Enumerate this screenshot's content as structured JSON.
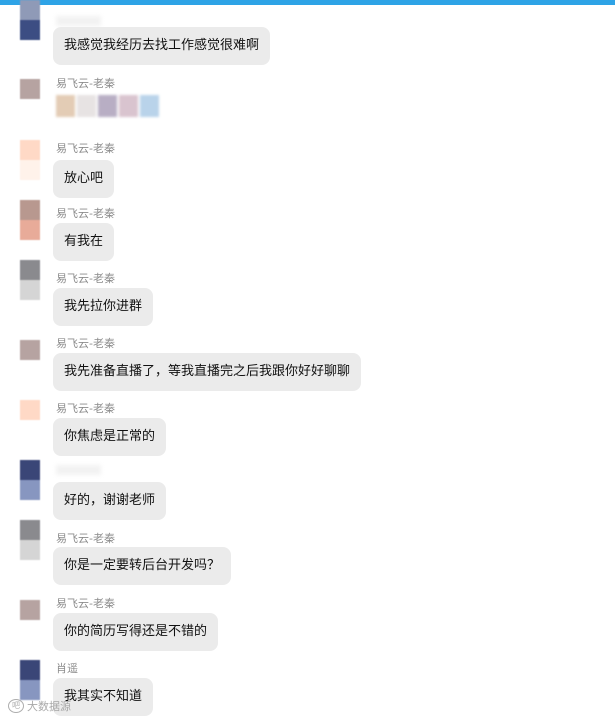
{
  "messages": [
    {
      "sender": "",
      "text": "我感觉我经历去找工作感觉很难啊",
      "avatar_colors": [
        "#8f9ab7",
        "#3c4d83"
      ]
    },
    {
      "sender": "易飞云-老秦",
      "text": "",
      "avatar_colors": [
        "#b6a3a1",
        "#ffffff"
      ],
      "sticker_colors": [
        "#e3ccb5",
        "#e7e3e3",
        "#b8aec4",
        "#d9c4cf",
        "#b9d3ea"
      ]
    },
    {
      "sender": "易飞云-老秦",
      "text": "放心吧",
      "avatar_colors": [
        "#ffd9c6",
        "#fff2ea"
      ]
    },
    {
      "sender": "易飞云-老秦",
      "text": "有我在",
      "avatar_colors": [
        "#b8988f",
        "#e8ab99"
      ]
    },
    {
      "sender": "易飞云-老秦",
      "text": "我先拉你进群",
      "avatar_colors": [
        "#8a8a8e",
        "#d5d5d5"
      ]
    },
    {
      "sender": "易飞云-老秦",
      "text": "我先准备直播了，等我直播完之后我跟你好好聊聊",
      "avatar_colors": [
        "#b6a3a1",
        "#ffffff"
      ]
    },
    {
      "sender": "易飞云-老秦",
      "text": "你焦虑是正常的",
      "avatar_colors": [
        "#ffd9c6",
        "#ffffff"
      ]
    },
    {
      "sender": "",
      "text": "好的，谢谢老师",
      "avatar_colors": [
        "#3a4677",
        "#8796c0"
      ]
    },
    {
      "sender": "易飞云-老秦",
      "text": "你是一定要转后台开发吗？",
      "avatar_colors": [
        "#8a8a8e",
        "#d5d5d5"
      ]
    },
    {
      "sender": "易飞云-老秦",
      "text": "你的简历写得还是不错的",
      "avatar_colors": [
        "#b6a3a1",
        "#ffffff"
      ]
    },
    {
      "sender": "肖遥",
      "text": "我其实不知道",
      "avatar_colors": [
        "#3a4677",
        "#8796c0"
      ]
    }
  ],
  "watermark": {
    "logo": "吧",
    "text": "大数据源"
  },
  "colors": {
    "accent": "#2ea3e6",
    "bubble": "#ebebeb",
    "sender_text": "#8c8c8c"
  }
}
